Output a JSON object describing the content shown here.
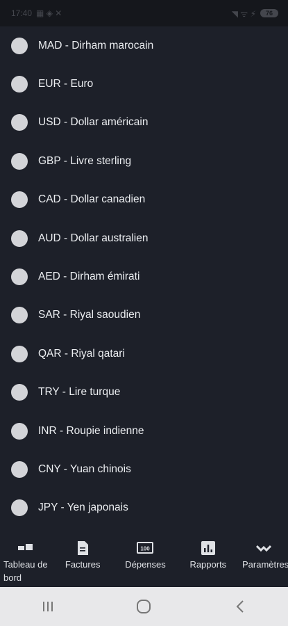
{
  "status_bar": {
    "time": "17:40",
    "battery": "76"
  },
  "currencies": [
    {
      "label": "MAD - Dirham marocain"
    },
    {
      "label": "EUR - Euro"
    },
    {
      "label": "USD - Dollar américain"
    },
    {
      "label": "GBP - Livre sterling"
    },
    {
      "label": "CAD - Dollar canadien"
    },
    {
      "label": "AUD - Dollar australien"
    },
    {
      "label": "AED - Dirham émirati"
    },
    {
      "label": "SAR - Riyal saoudien"
    },
    {
      "label": "QAR - Riyal qatari"
    },
    {
      "label": "TRY - Lire turque"
    },
    {
      "label": "INR - Roupie indienne"
    },
    {
      "label": "CNY - Yuan chinois"
    },
    {
      "label": "JPY - Yen japonais"
    }
  ],
  "bottom_nav": {
    "items": [
      {
        "label": "Tableau de bord",
        "icon": "dashboard-icon"
      },
      {
        "label": "Factures",
        "icon": "invoice-icon"
      },
      {
        "label": "Dépenses",
        "icon": "expenses-icon"
      },
      {
        "label": "Rapports",
        "icon": "reports-icon"
      },
      {
        "label": "Paramètres",
        "icon": "settings-icon"
      }
    ]
  },
  "colors": {
    "background": "#1d2029",
    "radio": "#d3d4d8",
    "system_nav": "#e8e8ea"
  }
}
